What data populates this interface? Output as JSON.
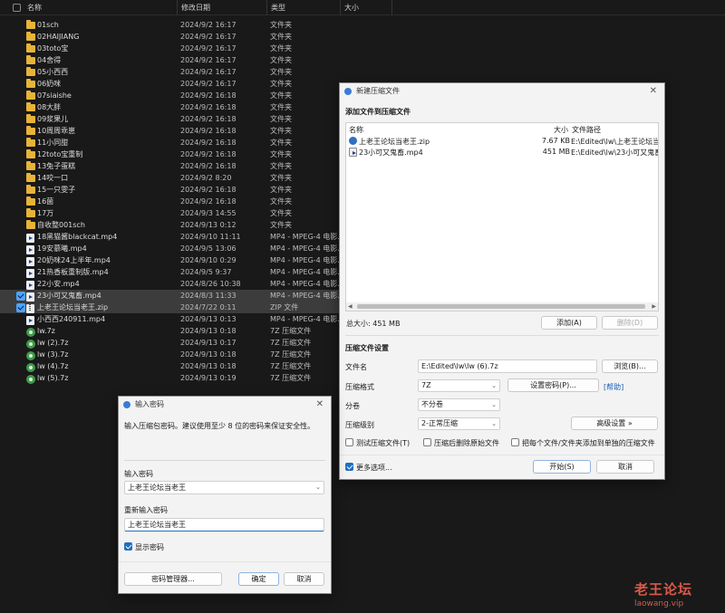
{
  "explorer": {
    "columns": {
      "name": "名称",
      "date": "修改日期",
      "type": "类型",
      "size": "大小"
    },
    "files": [
      {
        "name": "01sch",
        "date": "2024/9/2 16:17",
        "type": "文件夹",
        "icon": "folder",
        "selected": false
      },
      {
        "name": "02HAIJIANG",
        "date": "2024/9/2 16:17",
        "type": "文件夹",
        "icon": "folder",
        "selected": false
      },
      {
        "name": "03toto宝",
        "date": "2024/9/2 16:17",
        "type": "文件夹",
        "icon": "folder",
        "selected": false
      },
      {
        "name": "04舍得",
        "date": "2024/9/2 16:17",
        "type": "文件夹",
        "icon": "folder",
        "selected": false
      },
      {
        "name": "05小西西",
        "date": "2024/9/2 16:17",
        "type": "文件夹",
        "icon": "folder",
        "selected": false
      },
      {
        "name": "06奶咪",
        "date": "2024/9/2 16:17",
        "type": "文件夹",
        "icon": "folder",
        "selected": false
      },
      {
        "name": "07siaishe",
        "date": "2024/9/2 16:18",
        "type": "文件夹",
        "icon": "folder",
        "selected": false
      },
      {
        "name": "08大胖",
        "date": "2024/9/2 16:18",
        "type": "文件夹",
        "icon": "folder",
        "selected": false
      },
      {
        "name": "09浆果儿",
        "date": "2024/9/2 16:18",
        "type": "文件夹",
        "icon": "folder",
        "selected": false
      },
      {
        "name": "10周周乖崽",
        "date": "2024/9/2 16:18",
        "type": "文件夹",
        "icon": "folder",
        "selected": false
      },
      {
        "name": "11小同甜",
        "date": "2024/9/2 16:18",
        "type": "文件夹",
        "icon": "folder",
        "selected": false
      },
      {
        "name": "12toto宝重制",
        "date": "2024/9/2 16:18",
        "type": "文件夹",
        "icon": "folder",
        "selected": false
      },
      {
        "name": "13兔子蛋糕",
        "date": "2024/9/2 16:18",
        "type": "文件夹",
        "icon": "folder",
        "selected": false
      },
      {
        "name": "14咬一口",
        "date": "2024/9/2 8:20",
        "type": "文件夹",
        "icon": "folder",
        "selected": false
      },
      {
        "name": "15一只雯子",
        "date": "2024/9/2 16:18",
        "type": "文件夹",
        "icon": "folder",
        "selected": false
      },
      {
        "name": "16菌",
        "date": "2024/9/2 16:18",
        "type": "文件夹",
        "icon": "folder",
        "selected": false
      },
      {
        "name": "17万",
        "date": "2024/9/3 14:55",
        "type": "文件夹",
        "icon": "folder",
        "selected": false
      },
      {
        "name": "自收整001sch",
        "date": "2024/9/13 0:12",
        "type": "文件夹",
        "icon": "folder",
        "selected": false
      },
      {
        "name": "18黑猫酱blackcat.mp4",
        "date": "2024/9/10 11:11",
        "type": "MP4 - MPEG-4 电影...",
        "icon": "video",
        "selected": false
      },
      {
        "name": "19安慕曦.mp4",
        "date": "2024/9/5 13:06",
        "type": "MP4 - MPEG-4 电影...",
        "icon": "video",
        "selected": false
      },
      {
        "name": "20奶咪24上半年.mp4",
        "date": "2024/9/10 0:29",
        "type": "MP4 - MPEG-4 电影...",
        "icon": "video",
        "selected": false
      },
      {
        "name": "21热香板重制版.mp4",
        "date": "2024/9/5 9:37",
        "type": "MP4 - MPEG-4 电影...",
        "icon": "video",
        "selected": false
      },
      {
        "name": "22小安.mp4",
        "date": "2024/8/26 10:38",
        "type": "MP4 - MPEG-4 电影...",
        "icon": "video",
        "selected": false
      },
      {
        "name": "23小可又鬼畜.mp4",
        "date": "2024/8/3 11:33",
        "type": "MP4 - MPEG-4 电影...",
        "icon": "video",
        "selected": true
      },
      {
        "name": "上老王论坛当老王.zip",
        "date": "2024/7/22 0:11",
        "type": "ZIP 文件",
        "icon": "zip",
        "selected": true
      },
      {
        "name": "小西西240911.mp4",
        "date": "2024/9/13 0:13",
        "type": "MP4 - MPEG-4 电影...",
        "icon": "video",
        "selected": false
      },
      {
        "name": "lw.7z",
        "date": "2024/9/13 0:18",
        "type": "7Z 压缩文件",
        "icon": "7z",
        "selected": false
      },
      {
        "name": "lw (2).7z",
        "date": "2024/9/13 0:17",
        "type": "7Z 压缩文件",
        "icon": "7z",
        "selected": false
      },
      {
        "name": "lw (3).7z",
        "date": "2024/9/13 0:18",
        "type": "7Z 压缩文件",
        "icon": "7z",
        "selected": false
      },
      {
        "name": "lw (4).7z",
        "date": "2024/9/13 0:18",
        "type": "7Z 压缩文件",
        "icon": "7z",
        "selected": false
      },
      {
        "name": "lw (5).7z",
        "date": "2024/9/13 0:19",
        "type": "7Z 压缩文件",
        "icon": "7z",
        "selected": false
      }
    ]
  },
  "compress": {
    "title": "新建压缩文件",
    "add_section": "添加文件到压缩文件",
    "list_headers": {
      "name": "名称",
      "size": "大小",
      "path": "文件路径"
    },
    "list_items": [
      {
        "name": "上老王论坛当老王.zip",
        "size": "7.67 KB",
        "path": "E:\\Edited\\lw\\上老王论坛当老",
        "icon": "zip"
      },
      {
        "name": "23小可又鬼畜.mp4",
        "size": "451 MB",
        "path": "E:\\Edited\\lw\\23小可又鬼畜.",
        "icon": "video"
      }
    ],
    "total_size": "总大小: 451 MB",
    "add_button": "添加(A)",
    "delete_button": "删除(D)",
    "settings_section": "压缩文件设置",
    "filename_label": "文件名",
    "filename_value": "E:\\Edited\\lw\\lw (6).7z",
    "browse_button": "浏览(B)...",
    "format_label": "压缩格式",
    "format_value": "7Z",
    "set_password_button": "设置密码(P)...",
    "help_link": "[帮助]",
    "volume_label": "分卷",
    "volume_value": "不分卷",
    "level_label": "压缩级别",
    "level_value": "2-正常压缩",
    "advanced_button": "高级设置 »",
    "test_label": "测试压缩文件(T)",
    "delete_after_label": "压缩后删除原始文件",
    "each_separate_label": "把每个文件/文件夹添加到单独的压缩文件",
    "more_options_label": "更多选项...",
    "start_button": "开始(S)",
    "cancel_button": "取消"
  },
  "password": {
    "title": "输入密码",
    "hint": "输入压缩包密码。建议使用至少 8 位的密码来保证安全性。",
    "enter_label": "输入密码",
    "enter_value": "上老王论坛当老王",
    "reenter_label": "重新输入密码",
    "reenter_value": "上老王论坛当老王",
    "show_label": "显示密码",
    "manager_button": "密码管理器...",
    "ok_button": "确定",
    "cancel_button": "取消"
  },
  "watermark": {
    "line1": "老王论坛",
    "line2": "laowang.vip"
  }
}
